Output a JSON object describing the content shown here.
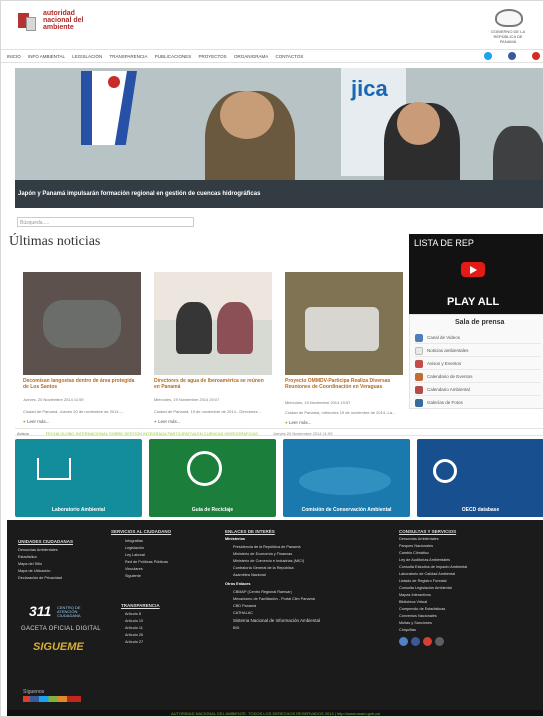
{
  "header": {
    "logo_line1": "autoridad",
    "logo_line2": "nacional del",
    "logo_line3": "ambiente",
    "seal_text": "GOBIERNO DE LA REPÚBLICA DE PANAMÁ"
  },
  "nav": [
    "INICIO",
    "INFO AMBIENTAL",
    "LEGISLACIÓN",
    "TRANSPARENCIA",
    "PUBLICACIONES",
    "PROYECTOS",
    "ORGANIGRAMA",
    "CONTACTOS"
  ],
  "hero": {
    "caption": "Japón y Panamá impulsarán formación regional en gestión de cuencas hidrográficas",
    "brand": "jica"
  },
  "search": {
    "placeholder": "Búsqueda....."
  },
  "main": {
    "section_title": "Últimas noticias",
    "news": [
      {
        "title": "Decomisan langostas dentro de área protegida de Los Santos",
        "date": "Jueves, 20 Noviembre 2014 11:59",
        "excerpt": "Ciudad de Panamá, Jueves 20 de noviembre de 2014.-...",
        "more": "Leer más..."
      },
      {
        "title": "Directores de agua de Iberoamérica se reúnen en Panamá",
        "date": "Miércoles, 19 Noviembre 2014 20:07",
        "excerpt": "Ciudad de Panamá, 19 de noviembre de 2014.- Directores...",
        "more": "Leer más..."
      },
      {
        "title": "Proyecto OMMDV-Participa Realiza Diversas Reuniones de Coordinación en Veraguas",
        "date": "Miércoles, 19 Noviembre 2014 19:57",
        "excerpt": "Ciudad de Panamá, miércoles 19 de noviembre de 2014.-La...",
        "more": "Leer más..."
      }
    ]
  },
  "video": {
    "playlist_label": "LISTA DE REP",
    "play_all": "PLAY ALL"
  },
  "press": {
    "title": "Sala de prensa",
    "items": [
      "Canal de Videos",
      "Noticias ambientales",
      "Avisos y Eventos",
      "Calendario de Eventos",
      "Calendario Ambiental",
      "Galerías de Fotos"
    ]
  },
  "ticker": {
    "label": "Avisos",
    "text": "FECHA GLOBO INTERNACIONAL SOBRE GESTIÓN INTEGRADA PARTICIPATIVA EN CUENCAS HIDROGRÁFICAS",
    "date": "Jueves 20 Noviembre 2014 11:59"
  },
  "banners": [
    {
      "label": "Laboratorio Ambiental",
      "color": "#138c9c"
    },
    {
      "label": "Guía de Reciclaje",
      "color": "#1b7e3b"
    },
    {
      "label": "Comisión de Conservación Ambiental",
      "color": "#1a79ad"
    },
    {
      "label": "OECD database",
      "color": "#174f8f"
    }
  ],
  "footer": {
    "col1_title": "UNIDADES CIUDADANAS",
    "col1": [
      "Denuncias Ambientales",
      "Estadística",
      "Mapa del Sitio",
      "Mapa de Ubicación",
      "Declaración de Privacidad"
    ],
    "col2_title": "SERVICIOS AL CIUDADANO",
    "col2": [
      "Infografías",
      "Legislación",
      "Ley Laboral",
      "Red de Políticas Públicas",
      "Vinculares",
      "Siguiente"
    ],
    "col3_title": "TRANSPARENCIA",
    "col3": [
      "Artículo 8",
      "Artículo 10",
      "Artículo 11",
      "Artículo 26",
      "Artículo 27"
    ],
    "col4_title": "ENLACES DE INTERÉS",
    "col4_sub1": "Ministerios",
    "col4": [
      "Presidencia de la República de Panamá",
      "Ministerio de Economía y Finanzas",
      "Ministerio de Comercio e Industrias (MICI)",
      "Contraloría General de la República",
      "Asamblea Nacional"
    ],
    "col4_sub2": "Otros Enlaces",
    "col4b": [
      "CBMAP (Centro Regional Ramsar)",
      "Mecanismo de Facilitación - Portal Clim Panamá",
      "CBD Panamá",
      "CATHALAC",
      "Sistema Nacional de Información Ambiental",
      "BID"
    ],
    "col5_title": "CONSULTAS Y SERVICIOS",
    "col5": [
      "Denuncias Ambientales",
      "Parques Nacionales",
      "Cambio Climático",
      "Ley de Auditorías Ambientales",
      "Consulta Estudios de Impacto Ambiental",
      "Laboratorio de Calidad Ambiental",
      "Listado de Registro Forestal",
      "Consulta Legislación Ambiental",
      "Mapas Interactivos",
      "Biblioteca Virtual",
      "Compendio de Estadísticas",
      "Convenios Nacionales",
      "Multas y Sanciones",
      "Chiquiñas"
    ],
    "brand1": "311",
    "brand1_sub": "CENTRO DE ATENCIÓN CIUDADANA",
    "brand2": "GACETA OFICIAL DIGITAL",
    "brand3": "SIGUEME",
    "bottom": "AUTORIDAD NACIONAL DEL AMBIENTE. TODOS LOS DERECHOS RESERVADOS 2014 | http://www.anam.gob.pa",
    "follow": "Síguenos"
  }
}
